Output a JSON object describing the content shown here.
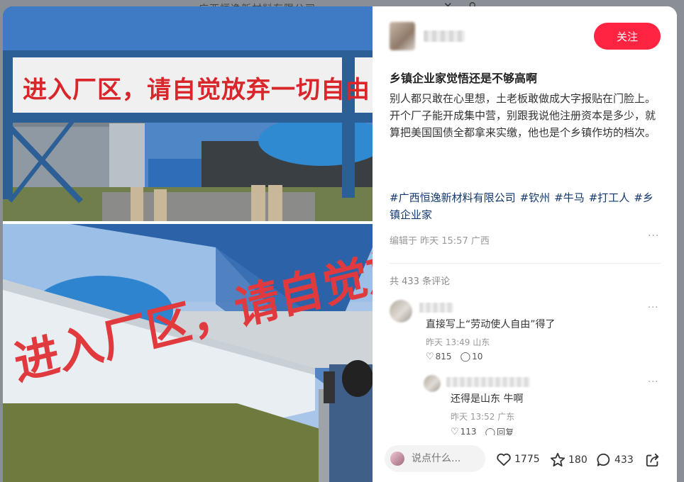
{
  "background": {
    "title": "广西恒逸新材料有限公司",
    "icons": [
      "close-icon",
      "search-icon"
    ]
  },
  "photos": {
    "top_sign": "进入厂区，请自觉放弃一切自由",
    "bottom_sign": "进入厂区，请自觉放弃一切自由"
  },
  "author": {
    "follow_label": "关注"
  },
  "post": {
    "title": "乡镇企业家觉悟还是不够高啊",
    "paragraphs": [
      "别人都只敢在心里想，土老板敢做成大字报贴在门脸上。",
      "开个厂子能开成集中营，别跟我说他注册资本是多少，就算把美国国债全都拿来实缴，他也是个乡镇作坊的档次。"
    ],
    "tags": [
      "#广西恒逸新材料有限公司",
      "#钦州",
      "#牛马",
      "#打工人",
      "#乡镇企业家"
    ],
    "meta": "编辑于 昨天 15:57 广西"
  },
  "comments": {
    "count_label": "共 433 条评论",
    "items": [
      {
        "text": "直接写上“劳动使人自由”得了",
        "time": "昨天 13:49 山东",
        "likes": "815",
        "replies": "10"
      },
      {
        "text": "还得是山东 牛啊",
        "time": "昨天 13:52 广东",
        "likes": "113",
        "replies": "回复"
      }
    ]
  },
  "bottombar": {
    "placeholder": "说点什么...",
    "likes": "1775",
    "stars": "180",
    "comments": "433"
  },
  "colors": {
    "accent": "#ff2442",
    "tag": "#13386c"
  }
}
